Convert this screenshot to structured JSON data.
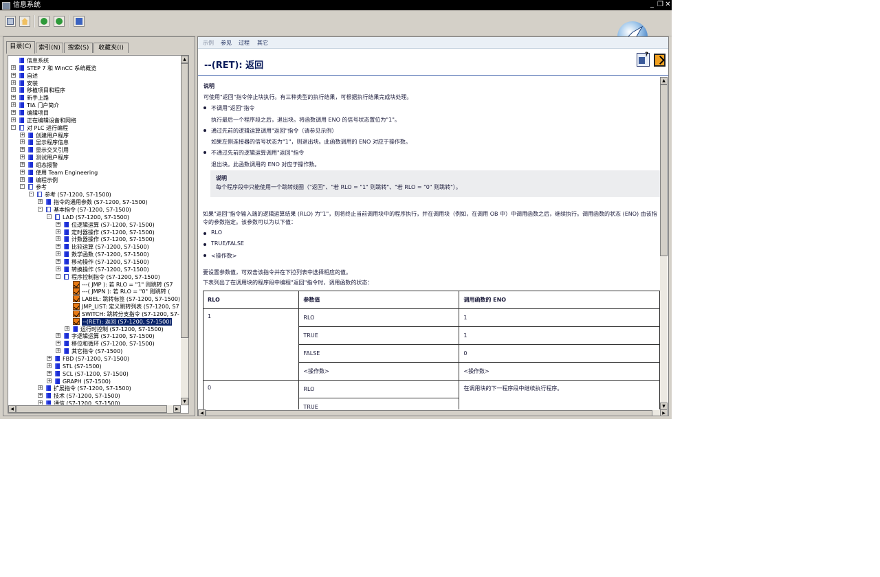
{
  "window": {
    "title": "信息系统",
    "controls": [
      "_",
      "❐",
      "✕"
    ]
  },
  "toolbar": {
    "icons": [
      "index-page-icon",
      "home-icon",
      "back-icon",
      "forward-icon",
      "print-icon"
    ]
  },
  "left_tabs": [
    "目录(C)",
    "索引(N)",
    "搜索(S)",
    "收藏夹(I)"
  ],
  "tree": [
    {
      "label": "信息系统",
      "indent": 0,
      "icon": "book-root",
      "exp": ""
    },
    {
      "label": "STEP 7 和 WinCC 系统概览",
      "indent": 0,
      "icon": "book",
      "exp": "+"
    },
    {
      "label": "自述",
      "indent": 0,
      "icon": "book",
      "exp": "+"
    },
    {
      "label": "安装",
      "indent": 0,
      "icon": "book",
      "exp": "+"
    },
    {
      "label": "移植项目和程序",
      "indent": 0,
      "icon": "book",
      "exp": "+"
    },
    {
      "label": "新手上路",
      "indent": 0,
      "icon": "book",
      "exp": "+"
    },
    {
      "label": "TIA 门户简介",
      "indent": 0,
      "icon": "book",
      "exp": "+"
    },
    {
      "label": "编辑项目",
      "indent": 0,
      "icon": "book",
      "exp": "+"
    },
    {
      "label": "正在编辑设备和网络",
      "indent": 0,
      "icon": "book",
      "exp": "+"
    },
    {
      "label": "对 PLC 进行编程",
      "indent": 0,
      "icon": "open",
      "exp": "-"
    },
    {
      "label": "创建用户程序",
      "indent": 1,
      "icon": "book",
      "exp": "+"
    },
    {
      "label": "显示程序信息",
      "indent": 1,
      "icon": "book",
      "exp": "+"
    },
    {
      "label": "显示交叉引用",
      "indent": 1,
      "icon": "book",
      "exp": "+"
    },
    {
      "label": "测试用户程序",
      "indent": 1,
      "icon": "book",
      "exp": "+"
    },
    {
      "label": "组态报警",
      "indent": 1,
      "icon": "book",
      "exp": "+"
    },
    {
      "label": "使用 Team Engineering",
      "indent": 1,
      "icon": "book",
      "exp": "+"
    },
    {
      "label": "编程示例",
      "indent": 1,
      "icon": "book",
      "exp": "+"
    },
    {
      "label": "参考",
      "indent": 1,
      "icon": "open",
      "exp": "-"
    },
    {
      "label": "参考 (S7-1200, S7-1500)",
      "indent": 2,
      "icon": "open",
      "exp": "-"
    },
    {
      "label": "指令的通用参数 (S7-1200, S7-1500)",
      "indent": 3,
      "icon": "book",
      "exp": "+"
    },
    {
      "label": "基本指令 (S7-1200, S7-1500)",
      "indent": 3,
      "icon": "open",
      "exp": "-"
    },
    {
      "label": "LAD (S7-1200, S7-1500)",
      "indent": 4,
      "icon": "open",
      "exp": "-"
    },
    {
      "label": "位逻辑运算 (S7-1200, S7-1500)",
      "indent": 5,
      "icon": "book",
      "exp": "+"
    },
    {
      "label": "定时器操作 (S7-1200, S7-1500)",
      "indent": 5,
      "icon": "book",
      "exp": "+"
    },
    {
      "label": "计数器操作 (S7-1200, S7-1500)",
      "indent": 5,
      "icon": "book",
      "exp": "+"
    },
    {
      "label": "比较运算 (S7-1200, S7-1500)",
      "indent": 5,
      "icon": "book",
      "exp": "+"
    },
    {
      "label": "数学函数 (S7-1200, S7-1500)",
      "indent": 5,
      "icon": "book",
      "exp": "+"
    },
    {
      "label": "移动操作 (S7-1200, S7-1500)",
      "indent": 5,
      "icon": "book",
      "exp": "+"
    },
    {
      "label": "转换操作 (S7-1200, S7-1500)",
      "indent": 5,
      "icon": "book",
      "exp": "+"
    },
    {
      "label": "程序控制指令 (S7-1200, S7-1500)",
      "indent": 5,
      "icon": "open",
      "exp": "-"
    },
    {
      "label": "---( JMP ): 若 RLO = \"1\" 则跳转 (S7",
      "indent": 6,
      "icon": "page",
      "exp": ""
    },
    {
      "label": "---( JMPN ): 若 RLO = \"0\" 则跳转 (",
      "indent": 6,
      "icon": "page",
      "exp": ""
    },
    {
      "label": "LABEL: 跳转标签 (S7-1200, S7-1500)",
      "indent": 6,
      "icon": "page",
      "exp": ""
    },
    {
      "label": "JMP_LIST: 定义跳转列表 (S7-1200, S7",
      "indent": 6,
      "icon": "page",
      "exp": ""
    },
    {
      "label": "SWITCH: 跳转分支指令 (S7-1200, S7-",
      "indent": 6,
      "icon": "page",
      "exp": ""
    },
    {
      "label": "--(RET): 返回 (S7-1200, S7-1500)",
      "indent": 6,
      "icon": "page",
      "exp": "",
      "selected": true
    },
    {
      "label": "运行时控制 (S7-1200, S7-1500)",
      "indent": 6,
      "icon": "book",
      "exp": "+"
    },
    {
      "label": "字逻辑运算 (S7-1200, S7-1500)",
      "indent": 5,
      "icon": "book",
      "exp": "+"
    },
    {
      "label": "移位和循环 (S7-1200, S7-1500)",
      "indent": 5,
      "icon": "book",
      "exp": "+"
    },
    {
      "label": "其它指令 (S7-1500)",
      "indent": 5,
      "icon": "book",
      "exp": "+"
    },
    {
      "label": "FBD (S7-1200, S7-1500)",
      "indent": 4,
      "icon": "book",
      "exp": "+"
    },
    {
      "label": "STL (S7-1500)",
      "indent": 4,
      "icon": "book",
      "exp": "+"
    },
    {
      "label": "SCL (S7-1200, S7-1500)",
      "indent": 4,
      "icon": "book",
      "exp": "+"
    },
    {
      "label": "GRAPH (S7-1500)",
      "indent": 4,
      "icon": "book",
      "exp": "+"
    },
    {
      "label": "扩展指令 (S7-1200, S7-1500)",
      "indent": 3,
      "icon": "book",
      "exp": "+"
    },
    {
      "label": "技术 (S7-1200, S7-1500)",
      "indent": 3,
      "icon": "book",
      "exp": "+"
    },
    {
      "label": "通信 (S7-1200, S7-1500)",
      "indent": 3,
      "icon": "book",
      "exp": "+"
    }
  ],
  "doc": {
    "nav": [
      "示例",
      "参见",
      "过程",
      "其它"
    ],
    "heading": "--(RET): 返回",
    "section_title": "说明",
    "intro": "可使用\"返回\"指令停止块执行。有三种类型的执行结果，可根据执行结果完成块处理。",
    "b1": "不调用\"返回\"指令",
    "b1_detail": "执行最后一个程序段之后，退出块。将函数调用 ENO 的信号状态置位为\"1\"。",
    "b2": "通过先前的逻辑运算调用\"返回\"指令（请参见示例）",
    "b2_detail": "如果左侧连接器的信号状态为\"1\"，则退出块。此函数调用的 ENO 对应于操作数。",
    "b3": "不通过先前的逻辑运算调用\"返回\"指令",
    "b3_detail": "退出块。此函数调用的 ENO 对应于操作数。",
    "note_title": "说明",
    "note_text": "每个程序段中只能使用一个跳转线圈（\"返回\"、\"若 RLO = \"1\" 则跳转\"、\"若 RLO = \"0\" 则跳转\"）。",
    "para2_line1": "如果\"返回\"指令输入端的逻辑运算结果 (RLO) 为\"1\"，则将终止当前调用块中的程序执行，并在调用块（例如，在调用 OB 中）中调用函数之后，继续执行。调用函数的状态 (ENO) 由该指",
    "para2_line2": "令的参数指定。该参数可以为以下值：",
    "vals": [
      "RLO",
      "TRUE/FALSE",
      "<操作数>"
    ],
    "para3": "要设置参数值，可双击该指令并在下拉列表中选择相应的值。",
    "para4": "下表列出了在调用块的程序段中编程\"返回\"指令时，调用函数的状态：",
    "table": {
      "headers": [
        "RLO",
        "参数值",
        "调用函数的 ENO"
      ],
      "rlo1": "1",
      "rows1": [
        [
          "RLO",
          "1"
        ],
        [
          "TRUE",
          "1"
        ],
        [
          "FALSE",
          "0"
        ],
        [
          "<操作数>",
          "<操作数>"
        ]
      ],
      "rlo0": "0",
      "rows0": [
        "RLO",
        "TRUE"
      ],
      "eno0": "在调用块的下一程序段中继续执行程序。"
    }
  }
}
